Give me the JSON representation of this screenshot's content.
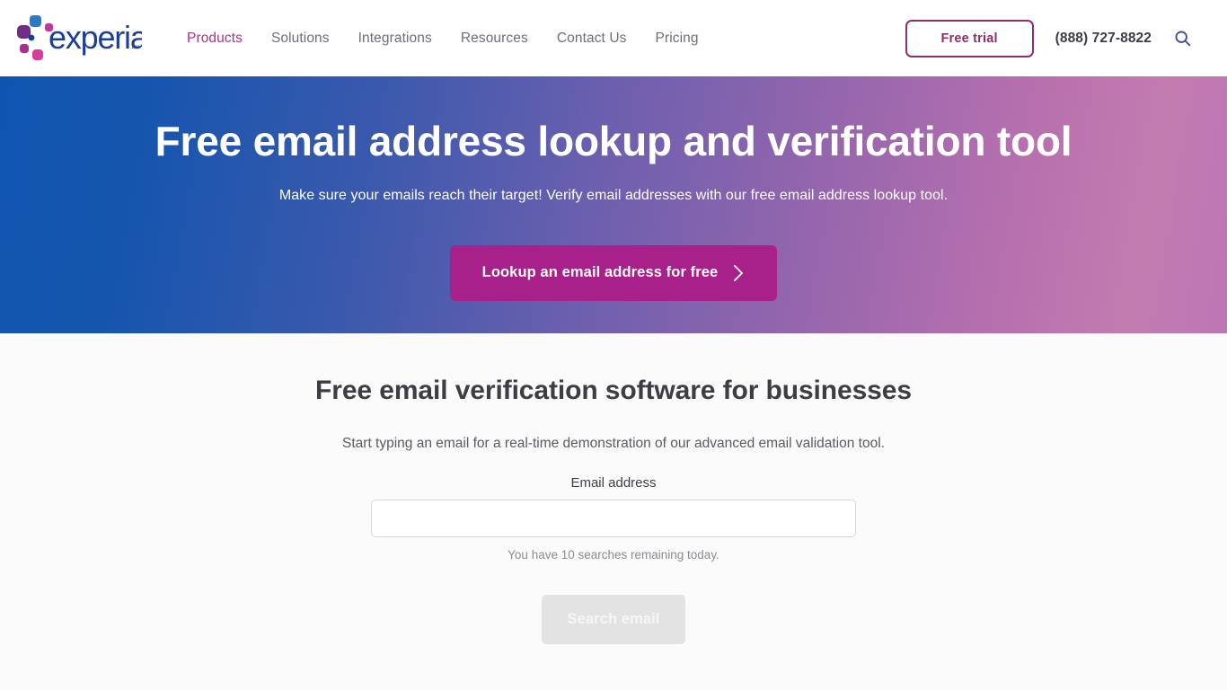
{
  "header": {
    "logo_alt": "experian",
    "logo_wordmark": "experian",
    "nav": [
      {
        "label": "Products",
        "active": true
      },
      {
        "label": "Solutions",
        "active": false
      },
      {
        "label": "Integrations",
        "active": false
      },
      {
        "label": "Resources",
        "active": false
      },
      {
        "label": "Contact Us",
        "active": false
      },
      {
        "label": "Pricing",
        "active": false
      }
    ],
    "free_trial_label": "Free trial",
    "phone": "(888) 727-8822",
    "search_icon": "search-icon"
  },
  "hero": {
    "title": "Free email address lookup and verification tool",
    "subtitle": "Make sure your emails reach their target! Verify email addresses with our free email address lookup tool.",
    "cta_label": "Lookup an email address for free",
    "cta_icon": "chevron-right-icon",
    "gradient_start": "#0f55b0",
    "gradient_end": "#bd76b4",
    "cta_color": "#a8208a"
  },
  "main": {
    "title": "Free email verification software for businesses",
    "subtitle": "Start typing an email for a real-time demonstration of our advanced email validation tool.",
    "form": {
      "email_label": "Email address",
      "email_value": "",
      "email_placeholder": "",
      "helper_text": "You have 10 searches remaining today.",
      "submit_label": "Search email",
      "submit_disabled": true
    }
  },
  "colors": {
    "brand_magenta": "#a9338b",
    "brand_purple": "#8b2f6e",
    "brand_blue": "#1055b0",
    "text_dark": "#3d3d46",
    "text_muted": "#6e6e78"
  }
}
